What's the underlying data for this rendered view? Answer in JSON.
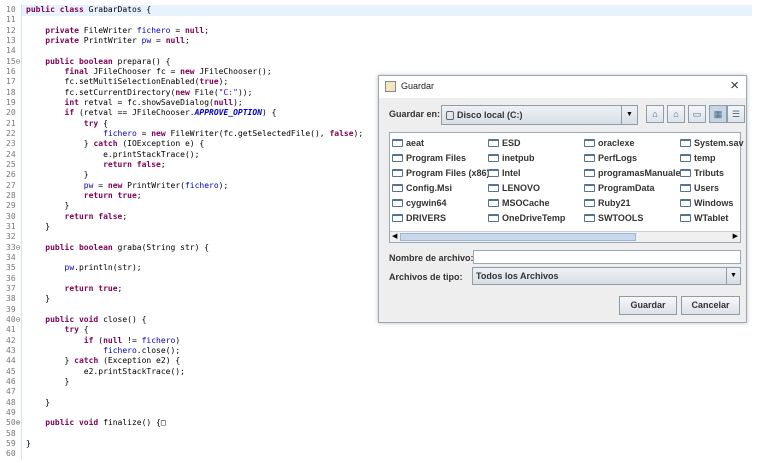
{
  "editor": {
    "lines": [
      {
        "n": "10",
        "t": [
          [
            "k",
            "public class "
          ],
          [
            "",
            "GrabarDatos {"
          ]
        ]
      },
      {
        "n": "11",
        "t": []
      },
      {
        "n": "12",
        "t": [
          [
            "",
            "    "
          ],
          [
            "k",
            "private "
          ],
          [
            "",
            "FileWriter "
          ],
          [
            "f",
            "fichero"
          ],
          [
            "",
            " = "
          ],
          [
            "k",
            "null"
          ],
          [
            "",
            ";"
          ]
        ]
      },
      {
        "n": "13",
        "t": [
          [
            "",
            "    "
          ],
          [
            "k",
            "private "
          ],
          [
            "",
            "PrintWriter "
          ],
          [
            "f",
            "pw"
          ],
          [
            "",
            " = "
          ],
          [
            "k",
            "null"
          ],
          [
            "",
            ";"
          ]
        ]
      },
      {
        "n": "14",
        "t": []
      },
      {
        "n": "15⊖",
        "t": [
          [
            "",
            "    "
          ],
          [
            "k",
            "public boolean "
          ],
          [
            "",
            "prepara() {"
          ]
        ]
      },
      {
        "n": "16",
        "t": [
          [
            "",
            "        "
          ],
          [
            "k",
            "final "
          ],
          [
            "",
            "JFileChooser fc = "
          ],
          [
            "k",
            "new "
          ],
          [
            "",
            "JFileChooser();"
          ]
        ]
      },
      {
        "n": "17",
        "t": [
          [
            "",
            "        fc.setMultiSelectionEnabled("
          ],
          [
            "k",
            "true"
          ],
          [
            "",
            ");"
          ]
        ]
      },
      {
        "n": "18",
        "t": [
          [
            "",
            "        fc.setCurrentDirectory("
          ],
          [
            "k",
            "new "
          ],
          [
            "",
            "File("
          ],
          [
            "s",
            "\"C:\""
          ],
          [
            "",
            "));"
          ]
        ]
      },
      {
        "n": "19",
        "t": [
          [
            "",
            "        "
          ],
          [
            "k",
            "int "
          ],
          [
            "",
            "retval = fc.showSaveDialog("
          ],
          [
            "k",
            "null"
          ],
          [
            "",
            ");"
          ]
        ]
      },
      {
        "n": "20",
        "t": [
          [
            "",
            "        "
          ],
          [
            "k",
            "if "
          ],
          [
            "",
            "(retval == JFileChooser."
          ],
          [
            "i",
            "APPROVE_OPTION"
          ],
          [
            "",
            ") {"
          ]
        ]
      },
      {
        "n": "21",
        "t": [
          [
            "",
            "            "
          ],
          [
            "k",
            "try "
          ],
          [
            "",
            "{"
          ]
        ]
      },
      {
        "n": "22",
        "t": [
          [
            "",
            "                "
          ],
          [
            "f",
            "fichero"
          ],
          [
            "",
            " = "
          ],
          [
            "k",
            "new "
          ],
          [
            "",
            "FileWriter(fc.getSelectedFile(), "
          ],
          [
            "k",
            "false"
          ],
          [
            "",
            ");"
          ]
        ]
      },
      {
        "n": "23",
        "t": [
          [
            "",
            "            } "
          ],
          [
            "k",
            "catch "
          ],
          [
            "",
            "(IOException e) {"
          ]
        ]
      },
      {
        "n": "24",
        "t": [
          [
            "",
            "                e.printStackTrace();"
          ]
        ]
      },
      {
        "n": "25",
        "t": [
          [
            "",
            "                "
          ],
          [
            "k",
            "return false"
          ],
          [
            "",
            ";"
          ]
        ]
      },
      {
        "n": "26",
        "t": [
          [
            "",
            "            }"
          ]
        ]
      },
      {
        "n": "27",
        "t": [
          [
            "",
            "            "
          ],
          [
            "f",
            "pw"
          ],
          [
            "",
            " = "
          ],
          [
            "k",
            "new "
          ],
          [
            "",
            "PrintWriter("
          ],
          [
            "f",
            "fichero"
          ],
          [
            "",
            ");"
          ]
        ]
      },
      {
        "n": "28",
        "t": [
          [
            "",
            "            "
          ],
          [
            "k",
            "return true"
          ],
          [
            "",
            ";"
          ]
        ]
      },
      {
        "n": "29",
        "t": [
          [
            "",
            "        }"
          ]
        ]
      },
      {
        "n": "30",
        "t": [
          [
            "",
            "        "
          ],
          [
            "k",
            "return false"
          ],
          [
            "",
            ";"
          ]
        ]
      },
      {
        "n": "31",
        "t": [
          [
            "",
            "    }"
          ]
        ]
      },
      {
        "n": "32",
        "t": []
      },
      {
        "n": "33⊖",
        "t": [
          [
            "",
            "    "
          ],
          [
            "k",
            "public boolean "
          ],
          [
            "",
            "graba(String str) {"
          ]
        ]
      },
      {
        "n": "34",
        "t": []
      },
      {
        "n": "35",
        "t": [
          [
            "",
            "        "
          ],
          [
            "f",
            "pw"
          ],
          [
            "",
            ".println(str);"
          ]
        ]
      },
      {
        "n": "36",
        "t": []
      },
      {
        "n": "37",
        "t": [
          [
            "",
            "        "
          ],
          [
            "k",
            "return true"
          ],
          [
            "",
            ";"
          ]
        ]
      },
      {
        "n": "38",
        "t": [
          [
            "",
            "    }"
          ]
        ]
      },
      {
        "n": "39",
        "t": []
      },
      {
        "n": "40⊖",
        "t": [
          [
            "",
            "    "
          ],
          [
            "k",
            "public void "
          ],
          [
            "",
            "close() {"
          ]
        ]
      },
      {
        "n": "41",
        "t": [
          [
            "",
            "        "
          ],
          [
            "k",
            "try "
          ],
          [
            "",
            "{"
          ]
        ]
      },
      {
        "n": "42",
        "t": [
          [
            "",
            "            "
          ],
          [
            "k",
            "if "
          ],
          [
            "",
            "("
          ],
          [
            "k",
            "null"
          ],
          [
            "",
            " != "
          ],
          [
            "f",
            "fichero"
          ],
          [
            "",
            ")"
          ]
        ]
      },
      {
        "n": "43",
        "t": [
          [
            "",
            "                "
          ],
          [
            "f",
            "fichero"
          ],
          [
            "",
            ".close();"
          ]
        ]
      },
      {
        "n": "44",
        "t": [
          [
            "",
            "        } "
          ],
          [
            "k",
            "catch "
          ],
          [
            "",
            "(Exception e2) {"
          ]
        ]
      },
      {
        "n": "45",
        "t": [
          [
            "",
            "            e2.printStackTrace();"
          ]
        ]
      },
      {
        "n": "46",
        "t": [
          [
            "",
            "        }"
          ]
        ]
      },
      {
        "n": "47",
        "t": []
      },
      {
        "n": "48",
        "t": [
          [
            "",
            "    }"
          ]
        ]
      },
      {
        "n": "49",
        "t": []
      },
      {
        "n": "50⊕",
        "t": [
          [
            "",
            "    "
          ],
          [
            "k",
            "public void "
          ],
          [
            "",
            "finalize() {□"
          ]
        ]
      },
      {
        "n": "58",
        "t": []
      },
      {
        "n": "59",
        "t": [
          [
            "",
            "}"
          ]
        ]
      },
      {
        "n": "60",
        "t": []
      }
    ]
  },
  "dialog": {
    "title": "Guardar",
    "close_icon": "×",
    "save_in_label": "Guardar en:",
    "save_in_value": "Disco local (C:)",
    "toolbar_icons": [
      "up-folder-icon",
      "home-icon",
      "new-folder-icon",
      "list-view-icon",
      "details-view-icon"
    ],
    "files": [
      [
        "aeat",
        "Program Files",
        "Program Files (x86)",
        "Config.Msi",
        "cygwin64",
        "DRIVERS"
      ],
      [
        "ESD",
        "inetpub",
        "Intel",
        "LENOVO",
        "MSOCache",
        "OneDriveTemp"
      ],
      [
        "oraclexe",
        "PerfLogs",
        "programasManuales",
        "ProgramData",
        "Ruby21",
        "SWTOOLS"
      ],
      [
        "System.sav",
        "temp",
        "Tributs",
        "Users",
        "Windows",
        "WTablet"
      ]
    ],
    "filename_label": "Nombre de archivo:",
    "filename_value": "",
    "filetype_label": "Archivos de tipo:",
    "filetype_value": "Todos los Archivos",
    "save_button": "Guardar",
    "cancel_button": "Cancelar"
  }
}
